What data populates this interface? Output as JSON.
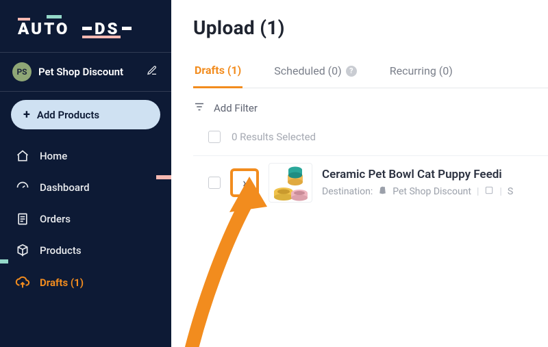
{
  "brand": "AUTO DS",
  "store": {
    "badge": "PS",
    "name": "Pet Shop Discount"
  },
  "sidebar": {
    "add_button": "Add Products",
    "items": [
      {
        "label": "Home"
      },
      {
        "label": "Dashboard"
      },
      {
        "label": "Orders"
      },
      {
        "label": "Products"
      },
      {
        "label": "Drafts (1)"
      }
    ]
  },
  "page": {
    "title": "Upload (1)",
    "tabs": [
      {
        "label": "Drafts (1)",
        "active": true
      },
      {
        "label": "Scheduled (0)",
        "help": true
      },
      {
        "label": "Recurring (0)"
      }
    ],
    "filter_label": "Add Filter",
    "selected_label": "0 Results Selected"
  },
  "item": {
    "title": "Ceramic Pet Bowl Cat Puppy Feedi",
    "destination_label": "Destination:",
    "destination_name": "Pet Shop Discount",
    "trailing": "S"
  }
}
